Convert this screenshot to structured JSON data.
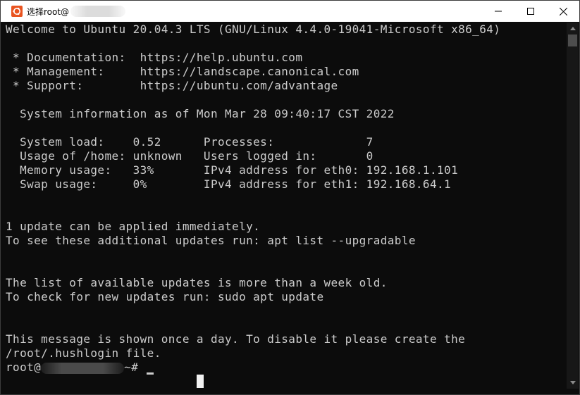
{
  "window": {
    "title": "选择root@",
    "icon": "ubuntu-icon",
    "controls": [
      "minimize-icon",
      "maximize-icon",
      "close-icon"
    ]
  },
  "background_window": {
    "left_chars": [
      "s",
      "u"
    ]
  },
  "terminal": {
    "lines": [
      "Welcome to Ubuntu 20.04.3 LTS (GNU/Linux 4.4.0-19041-Microsoft x86_64)",
      "",
      " * Documentation:  https://help.ubuntu.com",
      " * Management:     https://landscape.canonical.com",
      " * Support:        https://ubuntu.com/advantage",
      "",
      "  System information as of Mon Mar 28 09:40:17 CST 2022",
      "",
      "  System load:    0.52      Processes:             7",
      "  Usage of /home: unknown   Users logged in:       0",
      "  Memory usage:   33%       IPv4 address for eth0: 192.168.1.101",
      "  Swap usage:     0%        IPv4 address for eth1: 192.168.64.1",
      "",
      "",
      "1 update can be applied immediately.",
      "To see these additional updates run: apt list --upgradable",
      "",
      "",
      "The list of available updates is more than a week old.",
      "To check for new updates run: sudo apt update",
      "",
      "",
      "This message is shown once a day. To disable it please create the",
      "/root/.hushlogin file."
    ],
    "prompt_prefix": "root@",
    "prompt_suffix": "~# "
  },
  "colors": {
    "terminal_bg": "#0c0c0c",
    "terminal_fg": "#cccccc",
    "titlebar_bg": "#ffffff",
    "ubuntu_orange": "#e95420"
  }
}
